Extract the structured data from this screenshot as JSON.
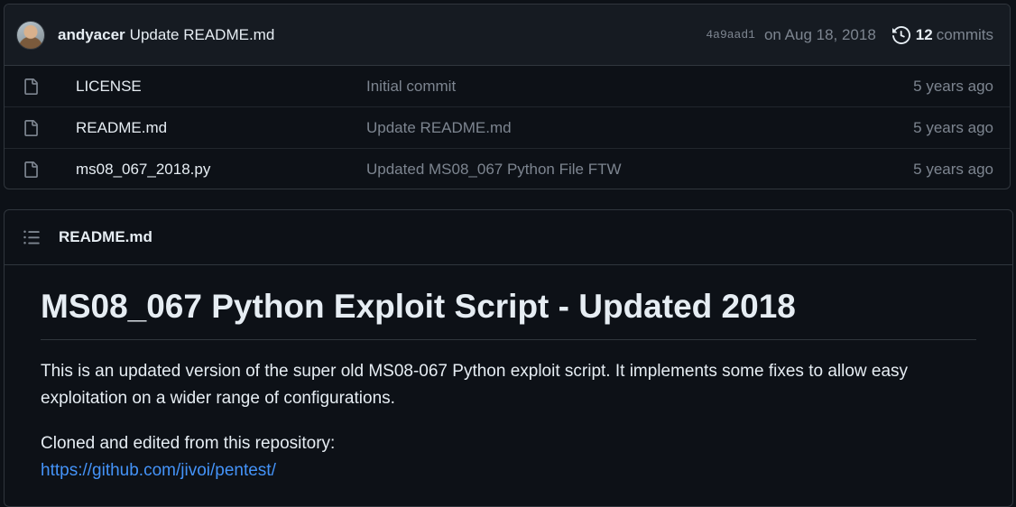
{
  "latest_commit": {
    "author": "andyacer",
    "message": "Update README.md",
    "sha": "4a9aad1",
    "date": "on Aug 18, 2018",
    "commit_count": "12",
    "commits_label": "commits"
  },
  "files": [
    {
      "name": "LICENSE",
      "message": "Initial commit",
      "age": "5 years ago"
    },
    {
      "name": "README.md",
      "message": "Update README.md",
      "age": "5 years ago"
    },
    {
      "name": "ms08_067_2018.py",
      "message": "Updated MS08_067 Python File FTW",
      "age": "5 years ago"
    }
  ],
  "readme": {
    "filename": "README.md",
    "title": "MS08_067 Python Exploit Script - Updated 2018",
    "paragraph1": "This is an updated version of the super old MS08-067 Python exploit script. It implements some fixes to allow easy exploitation on a wider range of configurations.",
    "paragraph2_text": "Cloned and edited from this repository:",
    "link": "https://github.com/jivoi/pentest/"
  },
  "colors": {
    "background": "#0d1117",
    "link": "#4493f8",
    "muted_text": "#7d8590",
    "border": "#30363d"
  }
}
